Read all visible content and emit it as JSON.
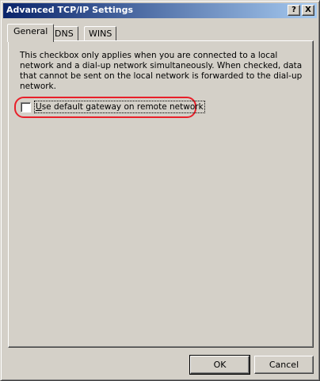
{
  "window": {
    "title": "Advanced TCP/IP Settings",
    "help_label": "?",
    "close_label": "X",
    "titlebar_color_start": "#0a246a",
    "titlebar_color_end": "#a6caf0"
  },
  "tabs": [
    {
      "label": "General",
      "selected": true
    },
    {
      "label": "DNS",
      "selected": false
    },
    {
      "label": "WINS",
      "selected": false
    }
  ],
  "general": {
    "description": "This checkbox only applies when you are connected to a local network and a dial-up network simultaneously.  When checked, data that cannot be sent on the local network is forwarded to the dial-up network.",
    "checkbox": {
      "label_underlined": "U",
      "label_rest": "se default gateway on remote network",
      "checked": false
    },
    "highlight_color": "#e8202a"
  },
  "buttons": {
    "ok": "OK",
    "cancel": "Cancel"
  }
}
